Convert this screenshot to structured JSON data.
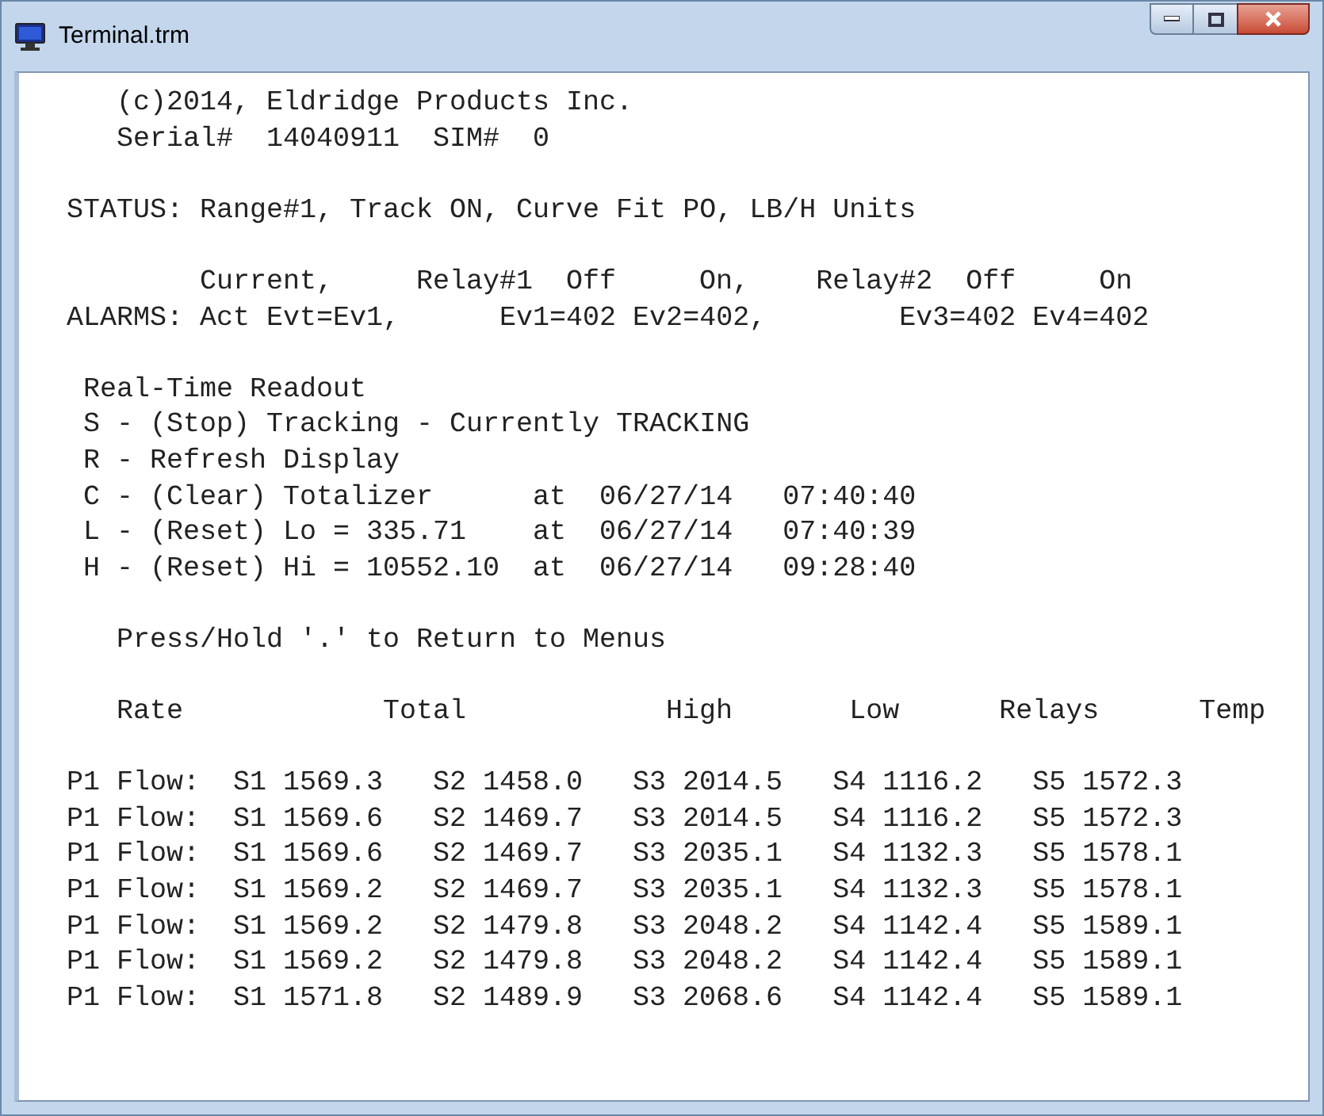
{
  "window": {
    "title": "Terminal.trm"
  },
  "header": [
    "(c)2014, Eldridge Products Inc.",
    "Serial#  14040911  SIM#  0"
  ],
  "status": "STATUS: Range#1, Track ON, Curve Fit PO, LB/H Units",
  "alarms": {
    "heading": "Current,     Relay#1  Off     On,    Relay#2  Off     On",
    "line": "ALARMS: Act Evt=Ev1,      Ev1=402 Ev2=402,        Ev3=402 Ev4=402"
  },
  "menu": {
    "title": "Real-Time Readout",
    "items": [
      "S - (Stop) Tracking - Currently TRACKING",
      "R - Refresh Display",
      "C - (Clear) Totalizer      at  06/27/14   07:40:40",
      "L - (Reset) Lo = 335.71    at  06/27/14   07:40:39",
      "H - (Reset) Hi = 10552.10  at  06/27/14   09:28:40"
    ]
  },
  "prompt": "Press/Hold '.' to Return to Menus",
  "legend_labels": [
    "Rate",
    "Total",
    "High",
    "Low",
    "Relays",
    "Temp"
  ],
  "readings": {
    "lines": [
      [
        "P1 Flow:",
        "S1 1569.3",
        "S2 1458.0",
        "S3 2014.5",
        "S4 1116.2",
        "S5 1572.3"
      ],
      [
        "P1 Flow:",
        "S1 1569.6",
        "S2 1469.7",
        "S3 2014.5",
        "S4 1116.2",
        "S5 1572.3"
      ],
      [
        "P1 Flow:",
        "S1 1569.6",
        "S2 1469.7",
        "S3 2035.1",
        "S4 1132.3",
        "S5 1578.1"
      ],
      [
        "P1 Flow:",
        "S1 1569.2",
        "S2 1469.7",
        "S3 2035.1",
        "S4 1132.3",
        "S5 1578.1"
      ],
      [
        "P1 Flow:",
        "S1 1569.2",
        "S2 1479.8",
        "S3 2048.2",
        "S4 1142.4",
        "S5 1589.1"
      ],
      [
        "P1 Flow:",
        "S1 1569.2",
        "S2 1479.8",
        "S3 2048.2",
        "S4 1142.4",
        "S5 1589.1"
      ],
      [
        "P1 Flow:",
        "S1 1571.8",
        "S2 1489.9",
        "S3 2068.6",
        "S4 1142.4",
        "S5 1589.1"
      ]
    ]
  }
}
